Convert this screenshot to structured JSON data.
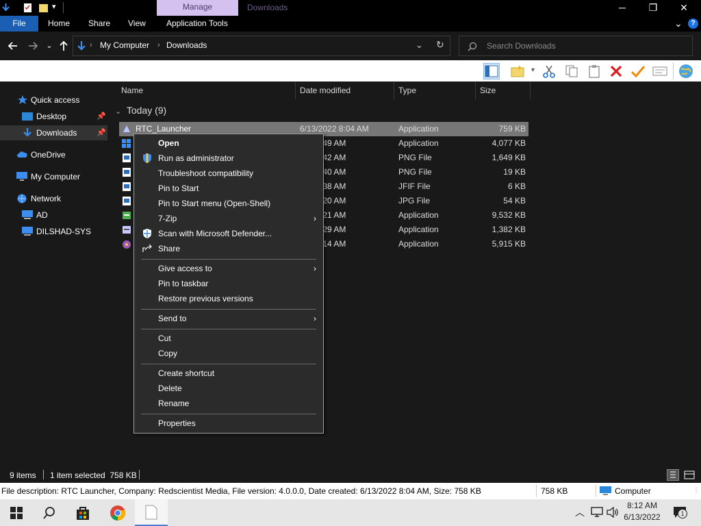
{
  "titlebar": {
    "context_tab": "Manage",
    "title": "Downloads",
    "minimize": "─",
    "maximize": "❐",
    "close": "✕"
  },
  "ribbon": {
    "tabs": [
      "File",
      "Home",
      "Share",
      "View",
      "Application Tools"
    ],
    "expand": "⌄",
    "help": "?"
  },
  "address": {
    "breadcrumb": [
      "My Computer",
      "Downloads"
    ],
    "separator": "›",
    "search_placeholder": "Search Downloads"
  },
  "nav": {
    "items": [
      {
        "label": "Quick access"
      },
      {
        "label": "Desktop"
      },
      {
        "label": "Downloads"
      },
      {
        "label": "OneDrive"
      },
      {
        "label": "My Computer"
      },
      {
        "label": "Network"
      },
      {
        "label": "AD"
      },
      {
        "label": "DILSHAD-SYS"
      }
    ]
  },
  "columns": [
    "Name",
    "Date modified",
    "Type",
    "Size"
  ],
  "group": {
    "label": "Today (9)"
  },
  "files": [
    {
      "name": "RTC_Launcher",
      "date": "6/13/2022 8:04 AM",
      "type": "Application",
      "size": "759 KB"
    },
    {
      "name": "",
      "date": "022 7:49 AM",
      "type": "Application",
      "size": "4,077 KB"
    },
    {
      "name": "",
      "date": "022 6:42 AM",
      "type": "PNG File",
      "size": "1,649 KB"
    },
    {
      "name": "",
      "date": "022 6:40 AM",
      "type": "PNG File",
      "size": "19 KB"
    },
    {
      "name": "",
      "date": "022 6:38 AM",
      "type": "JFIF File",
      "size": "6 KB"
    },
    {
      "name": "",
      "date": "022 6:20 AM",
      "type": "JPG File",
      "size": "54 KB"
    },
    {
      "name": "",
      "date": "022 5:21 AM",
      "type": "Application",
      "size": "9,532 KB"
    },
    {
      "name": "",
      "date": "022 4:29 AM",
      "type": "Application",
      "size": "1,382 KB"
    },
    {
      "name": "",
      "date": "022 3:14 AM",
      "type": "Application",
      "size": "5,915 KB"
    }
  ],
  "context_menu": {
    "items": [
      "Open",
      "Run as administrator",
      "Troubleshoot compatibility",
      "Pin to Start",
      "Pin to Start menu (Open-Shell)",
      "7-Zip",
      "Scan with Microsoft Defender...",
      "Share",
      "Give access to",
      "Pin to taskbar",
      "Restore previous versions",
      "Send to",
      "Cut",
      "Copy",
      "Create shortcut",
      "Delete",
      "Rename",
      "Properties"
    ],
    "arrow": "›"
  },
  "status": {
    "item_count": "9 items",
    "selection": "1 item selected  758 KB"
  },
  "description": {
    "text": "File description: RTC Launcher, Company: Redscientist Media, File version: 4.0.0.0, Date created: 6/13/2022 8:04 AM, Size: 758 KB",
    "size": "758 KB",
    "location": "Computer"
  },
  "taskbar": {
    "time": "8:12 AM",
    "date": "6/13/2022",
    "notification_count": "1"
  },
  "colors": {
    "accent": "#1a5fb4",
    "manage_tab": "#d4c1f0",
    "background": "#191919",
    "selection": "#777777",
    "menu_bg": "#2b2b2b"
  }
}
